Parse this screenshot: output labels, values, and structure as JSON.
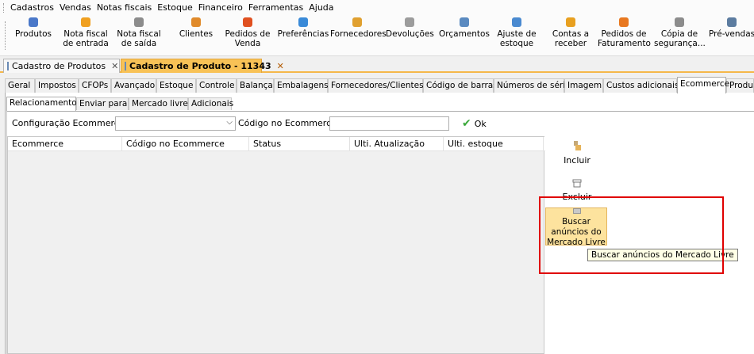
{
  "menu": [
    "Cadastros",
    "Vendas",
    "Notas fiscais",
    "Estoque",
    "Financeiro",
    "Ferramentas",
    "Ajuda"
  ],
  "toolbar": [
    {
      "label": "Produtos",
      "icon": "products-icon",
      "color": "#4a78c9"
    },
    {
      "label": "Nota fiscal\nde entrada",
      "icon": "invoice-in-icon",
      "color": "#f0a020"
    },
    {
      "label": "Nota fiscal\nde saída",
      "icon": "invoice-out-icon",
      "color": "#8c8c8c"
    },
    {
      "label": "Clientes",
      "icon": "clients-icon",
      "color": "#e08a2a"
    },
    {
      "label": "Pedidos de\nVenda",
      "icon": "sales-orders-icon",
      "color": "#e05020"
    },
    {
      "label": "Preferências",
      "icon": "preferences-icon",
      "color": "#3a8ad8"
    },
    {
      "label": "Fornecedores",
      "icon": "suppliers-icon",
      "color": "#e0a030"
    },
    {
      "label": "Devoluções",
      "icon": "returns-icon",
      "color": "#9c9c9c"
    },
    {
      "label": "Orçamentos",
      "icon": "quotes-icon",
      "color": "#5a8ac0"
    },
    {
      "label": "Ajuste de\nestoque",
      "icon": "stock-adjust-icon",
      "color": "#4a8ad0"
    },
    {
      "label": "Contas a\nreceber",
      "icon": "receivables-icon",
      "color": "#e8a020"
    },
    {
      "label": "Pedidos de\nFaturamento",
      "icon": "billing-orders-icon",
      "color": "#e87820"
    },
    {
      "label": "Cópia de\nsegurança...",
      "icon": "backup-icon",
      "color": "#8c8c8c"
    },
    {
      "label": "Pré-vendas",
      "icon": "pre-sales-icon",
      "color": "#5c7ca0"
    }
  ],
  "doc_tabs": [
    {
      "label": "Cadastro de Produtos",
      "active": false
    },
    {
      "label": "Cadastro de Produto - 11343",
      "active": true
    }
  ],
  "main_tabs": [
    "Geral",
    "Impostos",
    "CFOPs",
    "Avançado",
    "Estoque",
    "Controle",
    "Balança",
    "Embalagens",
    "Fornecedores/Clientes",
    "Código de barras",
    "Números de série",
    "Imagem",
    "Custos adicionais",
    "Ecommerce",
    "Produt"
  ],
  "main_tab_active": "Ecommerce",
  "sub_tabs": [
    "Relacionamento",
    "Enviar para",
    "Mercado livre",
    "Adicionais"
  ],
  "sub_tab_active": "Relacionamento",
  "filters": {
    "config_label": "Configuração Ecommerce:",
    "config_value": "",
    "code_label": "Código no Ecommerce:",
    "code_value": "",
    "ok_label": "Ok"
  },
  "grid": {
    "columns": [
      "Ecommerce",
      "Código no Ecommerce",
      "Status",
      "Ulti. Atualização",
      "Ulti. estoque"
    ]
  },
  "actions": {
    "include_label": "Incluir",
    "delete_label": "Excluir",
    "search_ml_label": "Buscar\nanúncios do\nMercado Livre",
    "tooltip": "Buscar anúncios do Mercado Livre"
  },
  "colors": {
    "active_doc_tab": "#f8c256",
    "hover_button": "#fde39e",
    "annotation": "#e00000"
  }
}
